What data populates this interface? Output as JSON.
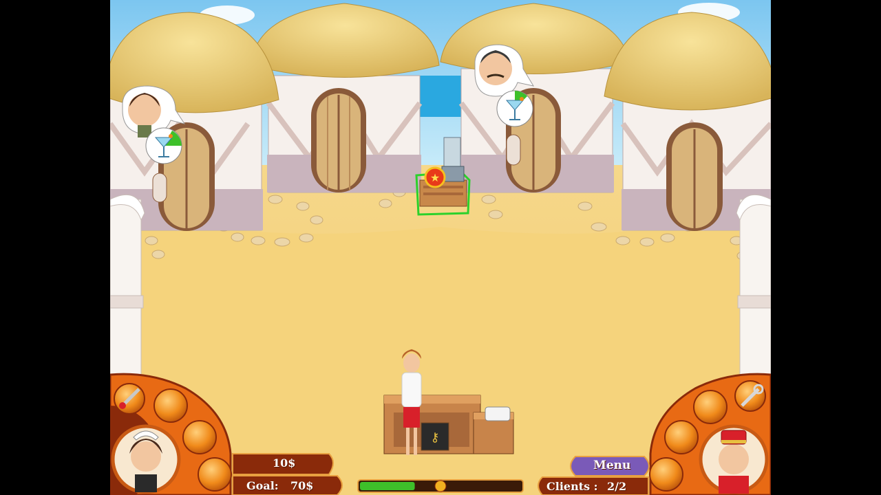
{
  "hud": {
    "money": "10$",
    "goal_label": "Goal:",
    "goal_value": "70$",
    "menu_label": "Menu",
    "clients_label": "Clients :",
    "clients_value": "2/2",
    "progress": 0.34
  },
  "characters": {
    "guest_1_request": "cocktail-icon",
    "guest_2_request": "cocktail-icon",
    "receptionist": "jane-receptionist",
    "maid_portrait": "maid-avatar",
    "bellboy_portrait": "bellboy-avatar"
  },
  "colors": {
    "sand": "#f2cf7a",
    "hud_orange": "#e86a14",
    "hud_dark": "#8a2a0a",
    "progress_green": "#3ec02a",
    "menu_purple": "#7a5ab8",
    "highlight_green": "#2bd12b"
  }
}
